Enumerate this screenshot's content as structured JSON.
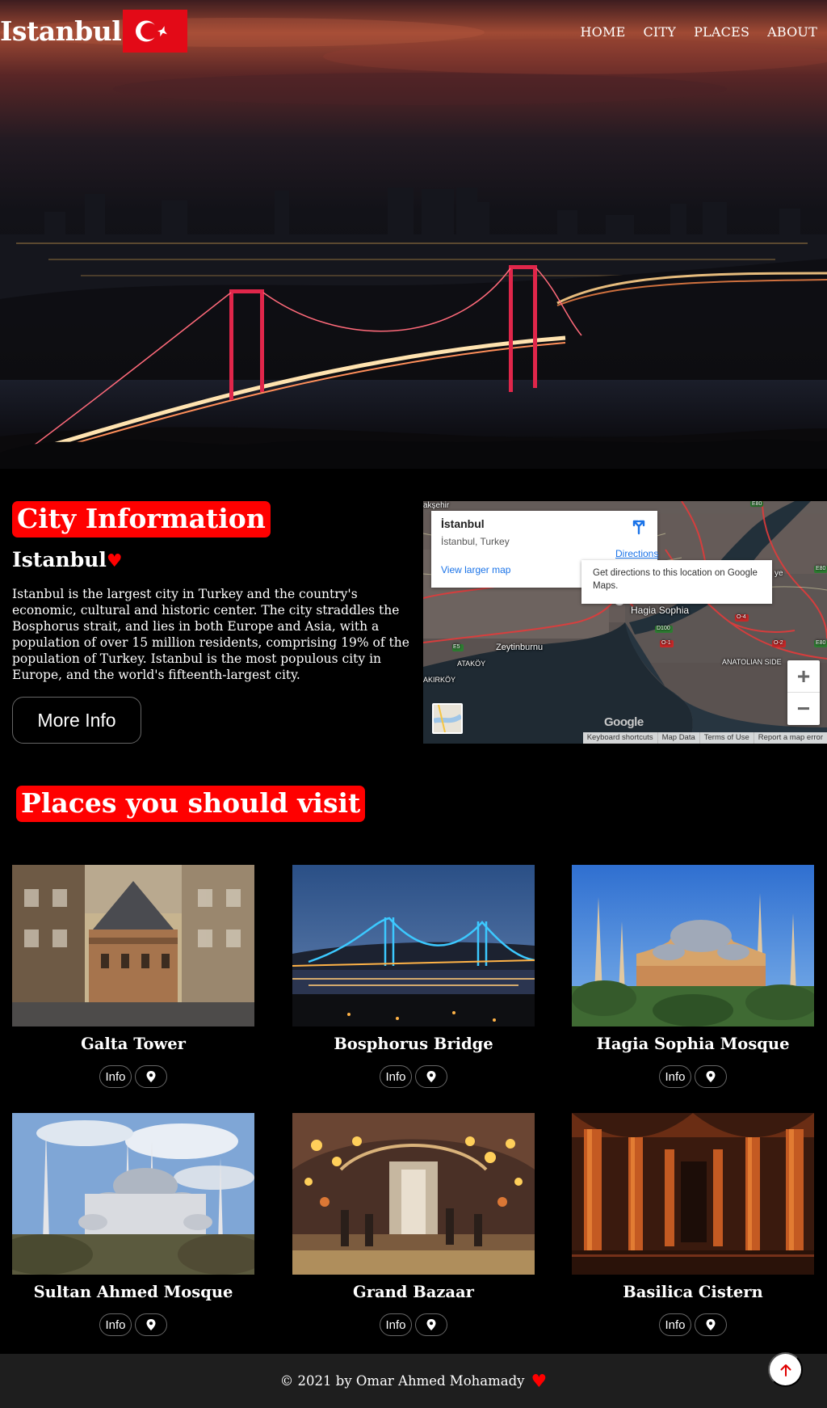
{
  "header": {
    "brand": "Istanbul",
    "flag_icon": "turkey-flag-icon",
    "nav": [
      {
        "label": "HOME"
      },
      {
        "label": "CITY"
      },
      {
        "label": "PLACES"
      },
      {
        "label": "ABOUT"
      }
    ]
  },
  "city": {
    "section_title": "City Information",
    "name": "Istanbul",
    "heart": "♥",
    "description": "Istanbul is the largest city in Turkey and the country's economic, cultural and historic center. The city straddles the Bosphorus strait, and lies in both Europe and Asia, with a population of over 15 million residents, comprising 19% of the population of Turkey. Istanbul is the most populous city in Europe, and the world's fifteenth-largest city.",
    "more_button": "More Info"
  },
  "map": {
    "place_title": "İstanbul",
    "place_sub": "İstanbul, Turkey",
    "larger_map": "View larger map",
    "directions": "Directions",
    "tooltip": "Get directions to this location on Google Maps.",
    "zoom_in": "+",
    "zoom_out": "−",
    "google": "Google",
    "footer": [
      "Keyboard shortcuts",
      "Map Data",
      "Terms of Use",
      "Report a map error"
    ],
    "labels": {
      "hagia": "Hagia Sophia",
      "zeytinburnu": "Zeytinburnu",
      "atakoy": "ATAKÖY",
      "bakirkoy": "AKIRKÖY",
      "anatolian": "ANATOLIAN SIDE",
      "aksehir": "akşehir",
      "e5": "E5",
      "d100": "D100",
      "o1": "O-1",
      "o2": "O-2",
      "o4": "O-4",
      "e80a": "E80",
      "e80b": "E80",
      "e80c": "E80",
      "ye": "ye"
    }
  },
  "places": {
    "section_title": "Places you should visit",
    "items": [
      {
        "name": "Galta Tower",
        "info": "Info",
        "icon": "map-pin-icon"
      },
      {
        "name": "Bosphorus Bridge",
        "info": "Info",
        "icon": "map-pin-icon"
      },
      {
        "name": "Hagia Sophia Mosque",
        "info": "Info",
        "icon": "map-pin-icon"
      },
      {
        "name": "Sultan Ahmed Mosque",
        "info": "Info",
        "icon": "map-pin-icon"
      },
      {
        "name": "Grand Bazaar",
        "info": "Info",
        "icon": "map-pin-icon"
      },
      {
        "name": "Basilica Cistern",
        "info": "Info",
        "icon": "map-pin-icon"
      }
    ]
  },
  "footer": {
    "text": "© 2021 by Omar Ahmed Mohamady",
    "heart": "♥",
    "up_icon": "arrow-up-icon"
  },
  "colors": {
    "accent": "#ff0000",
    "background": "#000000",
    "footer_bg": "#1e1e1e",
    "turkey_red": "#e30a17"
  }
}
